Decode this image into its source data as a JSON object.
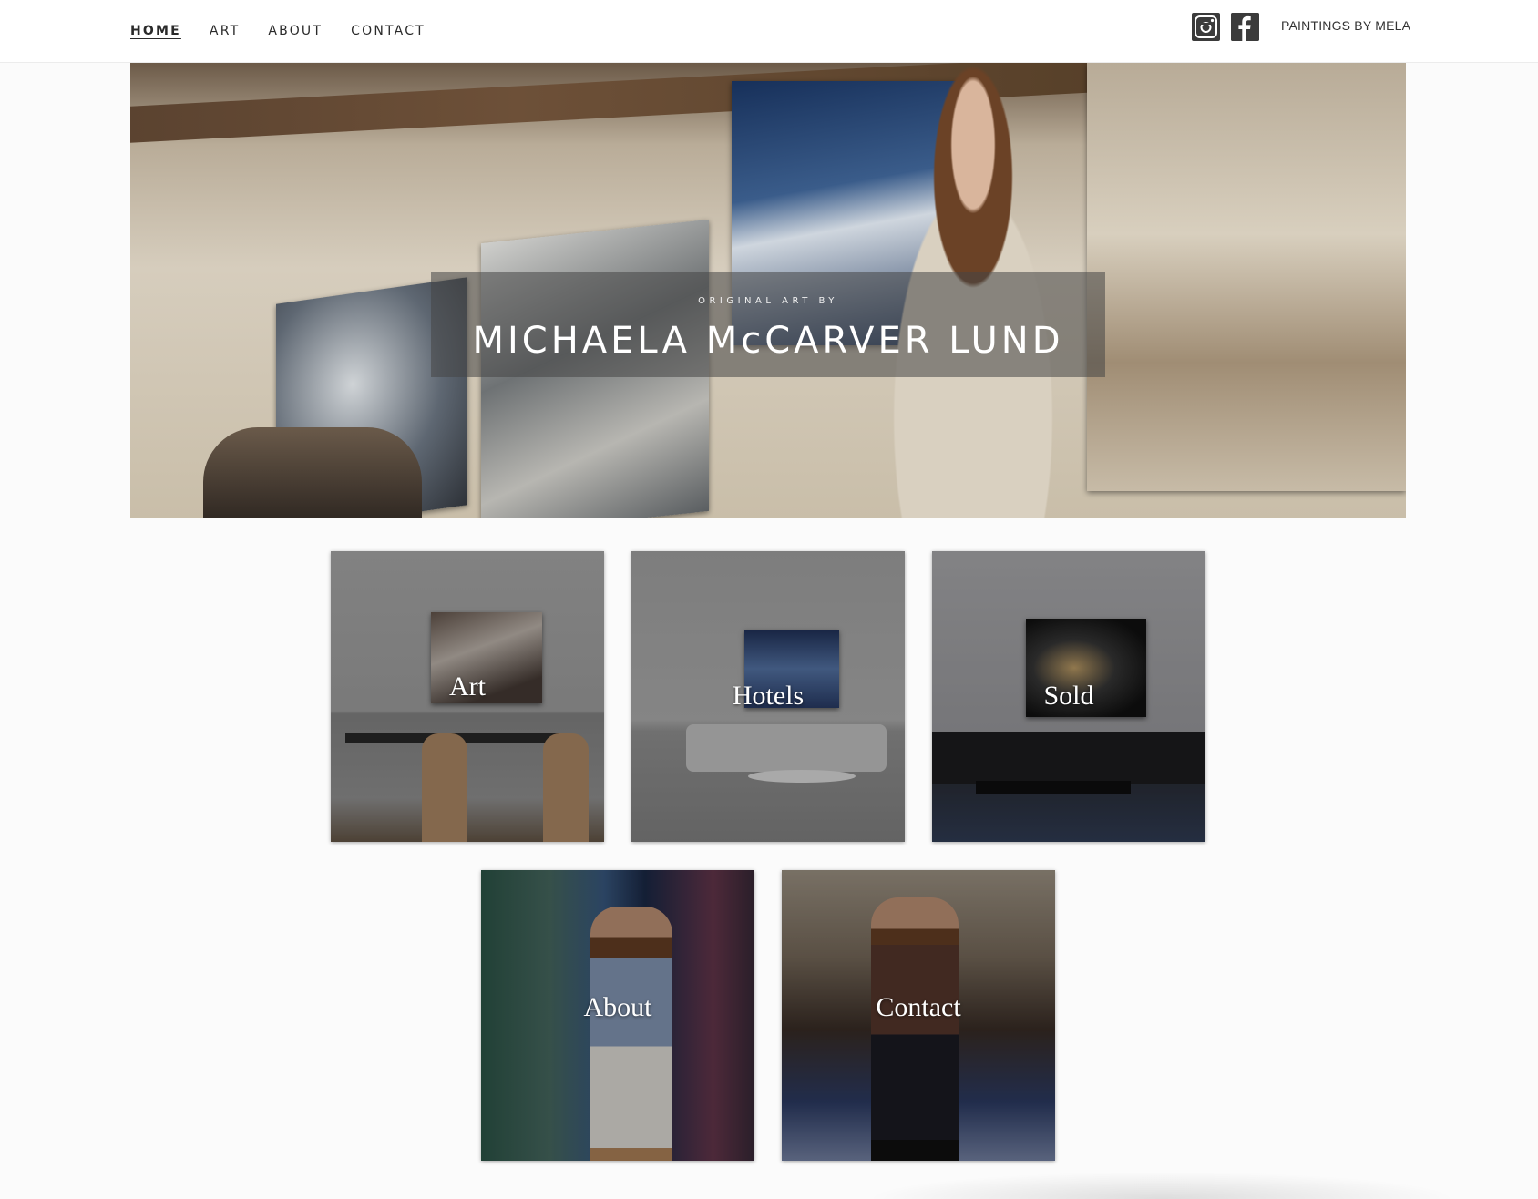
{
  "nav": {
    "items": [
      {
        "label": "HOME",
        "active": true
      },
      {
        "label": "ART",
        "active": false
      },
      {
        "label": "ABOUT",
        "active": false
      },
      {
        "label": "CONTACT",
        "active": false
      }
    ]
  },
  "header": {
    "social": [
      "instagram-icon",
      "facebook-icon"
    ],
    "brand": "PAINTINGS BY MELA"
  },
  "hero": {
    "kicker": "ORIGINAL ART BY",
    "name": "MICHAELA McCARVER LUND"
  },
  "tiles": [
    {
      "label": "Art"
    },
    {
      "label": "Hotels"
    },
    {
      "label": "Sold"
    },
    {
      "label": "About"
    },
    {
      "label": "Contact"
    }
  ],
  "colors": {
    "background": "#fbfbfb",
    "header": "#ffffff",
    "text": "#2a2a2a",
    "icon": "#3b3b3b"
  }
}
